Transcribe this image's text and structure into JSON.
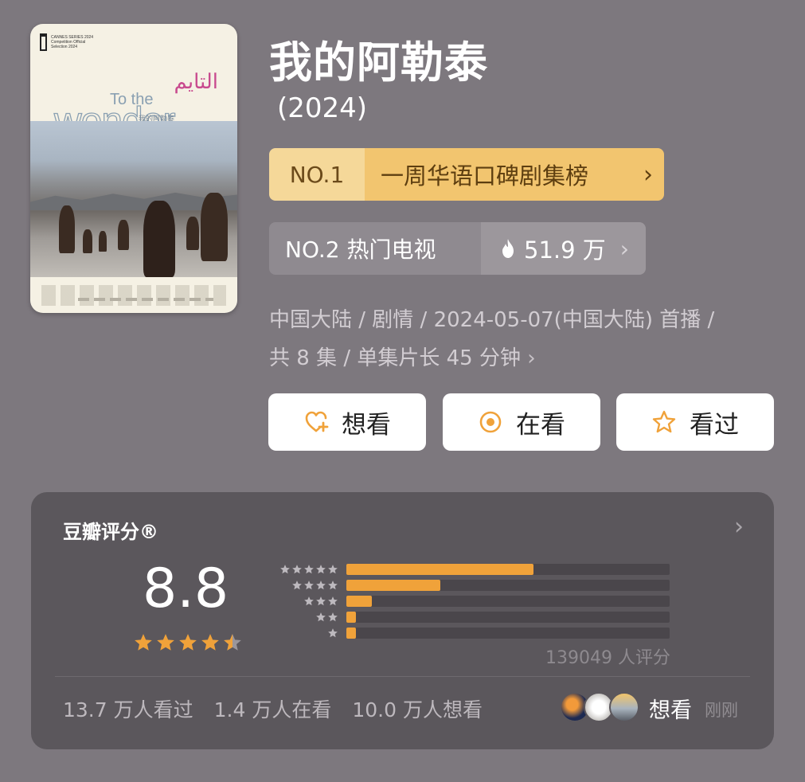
{
  "poster": {
    "festival_text": "CANNES SERIES 2024 Competition Official Selection 2024",
    "arabic_title": "التايم",
    "title_en_1": "To the",
    "title_en_2": "wonder",
    "title_cn_small": "我的阿勒泰"
  },
  "title": "我的阿勒泰",
  "year": "(2024)",
  "rank1": {
    "number": "NO.1",
    "label": "一周华语口碑剧集榜",
    "chevron": "›"
  },
  "rank2": {
    "label": "NO.2 热门电视",
    "heat": "51.9 万",
    "chevron": "›"
  },
  "info": {
    "line1": "中国大陆 / 剧情 / 2024-05-07(中国大陆) 首播 /",
    "line2": "共 8 集 / 单集片长 45 分钟",
    "chevron": "›"
  },
  "buttons": {
    "want": "想看",
    "watching": "在看",
    "watched": "看过"
  },
  "rating": {
    "header": "豆瓣评分®",
    "score": "8.8",
    "stars": 4.5,
    "distribution": [
      {
        "stars": 5,
        "fraction": 0.58
      },
      {
        "stars": 4,
        "fraction": 0.29
      },
      {
        "stars": 3,
        "fraction": 0.08
      },
      {
        "stars": 2,
        "fraction": 0.03
      },
      {
        "stars": 1,
        "fraction": 0.03
      }
    ],
    "count": "139049 人评分",
    "stats": {
      "watched": "13.7 万人看过",
      "watching": "1.4 万人在看",
      "want": "10.0 万人想看"
    },
    "recent_action": "想看",
    "recent_time": "刚刚"
  },
  "colors": {
    "background": "#7d787e",
    "gold_light": "#f5d899",
    "gold": "#f2c56f",
    "accent_orange": "#f0a23a",
    "card": "#5b575c"
  }
}
